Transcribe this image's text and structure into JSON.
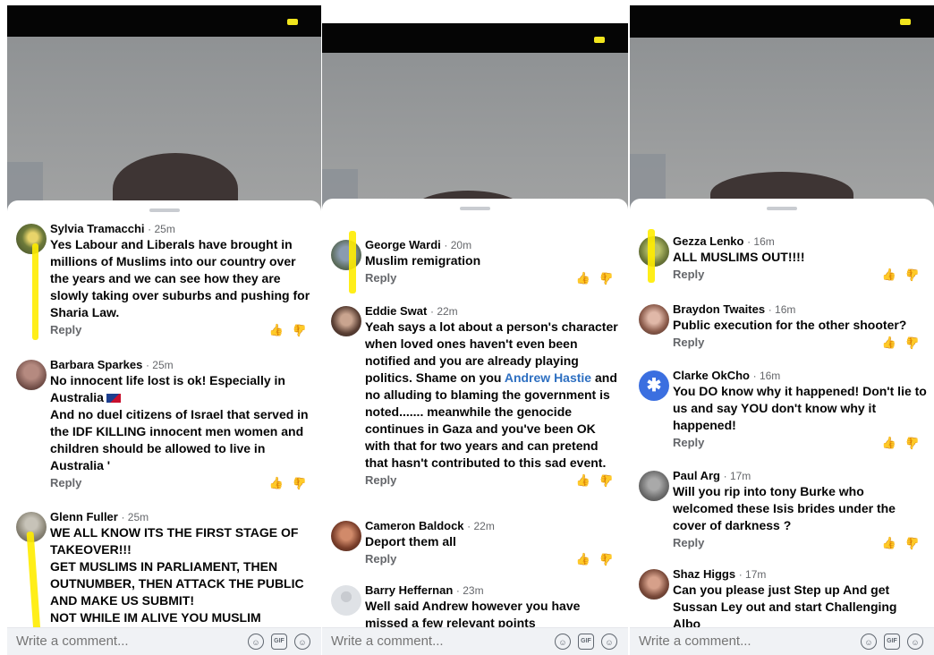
{
  "ui": {
    "reply_label": "Reply",
    "like_symbol": "👍",
    "dislike_symbol": "👍",
    "composer_placeholder": "Write a comment...",
    "sticker_glyph": "☺",
    "gif_glyph": "GIF",
    "emoji_glyph": "☺",
    "highlight_color": "#ffec00",
    "mention_color": "#2d6fc1",
    "status_battery_color": "#f1e51d"
  },
  "panels": [
    {
      "comments": [
        {
          "name": "Sylvia Tramacchi",
          "time": "· 25m",
          "text": "Yes Labour and Liberals have brought in millions of Muslims into our country over the years and we can see how they are slowly taking over suburbs and pushing for Sharia Law."
        },
        {
          "name": "Barbara Sparkes",
          "time": "· 25m",
          "text": "No innocent life lost is ok! Especially in Australia",
          "text2": "And no duel citizens of Israel that served in the IDF KILLING innocent men women and children should be allowed to live in Australia '"
        },
        {
          "name": "Glenn Fuller",
          "time": "· 25m",
          "text": "WE ALL KNOW ITS THE FIRST STAGE OF TAKEOVER!!!",
          "text2": "GET MUSLIMS IN PARLIAMENT, THEN OUTNUMBER, THEN ATTACK THE PUBLIC AND MAKE US SUBMIT!",
          "text3": "NOT WHILE IM ALIVE YOU MUSLIM"
        }
      ]
    },
    {
      "comments": [
        {
          "name": "George Wardi",
          "time": "· 20m",
          "text": "Muslim remigration"
        },
        {
          "name": "Eddie Swat",
          "time": "· 22m",
          "text": "Yeah says a lot about a person's character when loved ones haven't even been notified and you are already playing politics. Shame on you",
          "mention": "Andrew Hastie",
          "text_after": "and no alluding to blaming the government is noted....... meanwhile the genocide continues in Gaza and you've been OK with that for two years and can pretend that hasn't contributed to this sad event."
        },
        {
          "name": "Cameron Baldock",
          "time": "· 22m",
          "text": "Deport them all"
        },
        {
          "name": "Barry Heffernan",
          "time": "· 23m",
          "text": "Well said Andrew however you have missed a few relevant points"
        }
      ]
    },
    {
      "comments": [
        {
          "name": "Gezza Lenko",
          "time": "· 16m",
          "text": "ALL MUSLIMS OUT!!!!"
        },
        {
          "name": "Braydon Twaites",
          "time": "· 16m",
          "text": "Public execution for the other shooter?"
        },
        {
          "name": "Clarke OkCho",
          "time": "· 16m",
          "text": "You DO know why it happened! Don't lie to us and say YOU don't know why it happened!"
        },
        {
          "name": "Paul Arg",
          "time": "· 17m",
          "text": "Will you rip into tony Burke who welcomed these Isis brides under the cover of darkness ?"
        },
        {
          "name": "Shaz Higgs",
          "time": "· 17m",
          "text": "Can you please just Step up And get Sussan Ley out and start Challenging Albo"
        }
      ]
    }
  ]
}
